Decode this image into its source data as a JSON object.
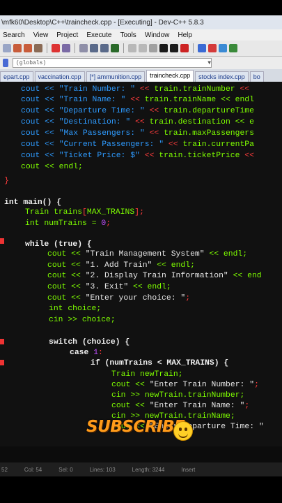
{
  "window": {
    "title": "\\mfk60\\Desktop\\C++\\traincheck.cpp - [Executing] - Dev-C++ 5.8.3"
  },
  "menu": [
    "Search",
    "View",
    "Project",
    "Execute",
    "Tools",
    "Window",
    "Help"
  ],
  "scope": {
    "value": "(globals)"
  },
  "tabs": [
    {
      "label": "epart.cpp",
      "active": false
    },
    {
      "label": "vaccination.cpp",
      "active": false
    },
    {
      "label": "[*] ammunition.cpp",
      "active": false
    },
    {
      "label": "traincheck.cpp",
      "active": true
    },
    {
      "label": "stocks index.cpp",
      "active": false
    },
    {
      "label": "bo",
      "active": false
    }
  ],
  "code": [
    [
      [
        "cout << ",
        "s"
      ],
      [
        "\"Train Number: \"",
        "s"
      ],
      [
        " << ",
        "o"
      ],
      [
        "train.trainNumber",
        "g"
      ],
      [
        " << ",
        "o"
      ]
    ],
    [
      [
        "cout << ",
        "s"
      ],
      [
        "\"Train Name: \"",
        "s"
      ],
      [
        " << ",
        "o"
      ],
      [
        "train.trainName",
        "g"
      ],
      [
        " << endl",
        "g"
      ]
    ],
    [
      [
        "cout << ",
        "s"
      ],
      [
        "\"Departure Time: \"",
        "s"
      ],
      [
        " << ",
        "o"
      ],
      [
        "train.departureTime",
        "g"
      ]
    ],
    [
      [
        "cout << ",
        "s"
      ],
      [
        "\"Destination: \"",
        "s"
      ],
      [
        " << ",
        "o"
      ],
      [
        "train.destination",
        "g"
      ],
      [
        " << e",
        "g"
      ]
    ],
    [
      [
        "cout << ",
        "s"
      ],
      [
        "\"Max Passengers: \"",
        "s"
      ],
      [
        " << ",
        "o"
      ],
      [
        "train.maxPassengers",
        "g"
      ]
    ],
    [
      [
        "cout << ",
        "s"
      ],
      [
        "\"Current Passengers: \"",
        "s"
      ],
      [
        " << ",
        "o"
      ],
      [
        "train.currentPa",
        "g"
      ]
    ],
    [
      [
        "cout << ",
        "s"
      ],
      [
        "\"Ticket Price: $\"",
        "s"
      ],
      [
        " << ",
        "o"
      ],
      [
        "train.ticketPrice",
        "g"
      ],
      [
        " <<",
        "o"
      ]
    ],
    [
      [
        "cout << endl;",
        "g"
      ]
    ],
    [
      [
        "}",
        "o"
      ]
    ],
    [
      [
        "int main() {",
        "k"
      ]
    ],
    [
      [
        "Train trains",
        "g"
      ],
      [
        "[",
        "o"
      ],
      [
        "MAX_TRAINS",
        "g"
      ],
      [
        "];",
        "o"
      ]
    ],
    [
      [
        "int numTrains = ",
        "g"
      ],
      [
        "0",
        "n"
      ],
      [
        ";",
        "o"
      ]
    ],
    [
      [
        "while (true) {",
        "k"
      ]
    ],
    [
      [
        "cout << ",
        "g"
      ],
      [
        "\"Train Management System\"",
        "t"
      ],
      [
        " << endl;",
        "g"
      ]
    ],
    [
      [
        "cout << ",
        "g"
      ],
      [
        "\"1. Add Train\"",
        "t"
      ],
      [
        " << endl;",
        "g"
      ]
    ],
    [
      [
        "cout << ",
        "g"
      ],
      [
        "\"2. Display Train Information\"",
        "t"
      ],
      [
        " << end",
        "g"
      ]
    ],
    [
      [
        "cout << ",
        "g"
      ],
      [
        "\"3. Exit\"",
        "t"
      ],
      [
        " << endl;",
        "g"
      ]
    ],
    [
      [
        "cout << ",
        "g"
      ],
      [
        "\"Enter your choice: \"",
        "t"
      ],
      [
        ";",
        "o"
      ]
    ],
    [
      [
        "int choice;",
        "g"
      ]
    ],
    [
      [
        "cin >> choice;",
        "g"
      ]
    ],
    [
      [
        "switch (choice) {",
        "k"
      ]
    ],
    [
      [
        "case ",
        "k"
      ],
      [
        "1",
        "n"
      ],
      [
        ":",
        "o"
      ]
    ],
    [
      [
        "if (numTrains < MAX_TRAINS) {",
        "k"
      ]
    ],
    [
      [
        "Train newTrain;",
        "g"
      ]
    ],
    [
      [
        "cout << ",
        "g"
      ],
      [
        "\"Enter Train Number: \"",
        "t"
      ],
      [
        ";",
        "o"
      ]
    ],
    [
      [
        "cin >> newTrain.trainNumber;",
        "g"
      ]
    ],
    [
      [
        "cout << ",
        "g"
      ],
      [
        "\"Enter Train Name: \"",
        "t"
      ],
      [
        ";",
        "o"
      ]
    ],
    [
      [
        "cin >> newTrain.trainName;",
        "g"
      ]
    ],
    [
      [
        "cout << ",
        "g"
      ],
      [
        "\"Enter Departure Time: \"",
        "t"
      ],
      [
        " ",
        "o"
      ]
    ]
  ],
  "status": {
    "line": "52",
    "col": "Col: 54",
    "sel": "Sel: 0",
    "lines": "Lines: 103",
    "length": "Length: 3244",
    "mode": "Insert"
  },
  "overlay": {
    "text": "SUBSCRIBE"
  }
}
